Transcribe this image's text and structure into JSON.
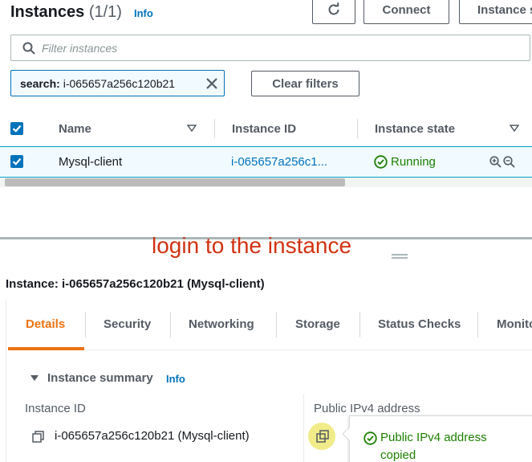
{
  "header": {
    "title": "Instances",
    "count": "(1/1)",
    "info": "Info",
    "connect_label": "Connect",
    "instance_state_label": "Instance s"
  },
  "search": {
    "placeholder": "Filter instances"
  },
  "filter_token": {
    "key": "search:",
    "value": "i-065657a256c120b21"
  },
  "clear_filters_label": "Clear filters",
  "table": {
    "columns": [
      "Name",
      "Instance ID",
      "Instance state"
    ],
    "rows": [
      {
        "name": "Mysql-client",
        "instance_id": "i-065657a256c1...",
        "state": "Running"
      }
    ]
  },
  "annotation": "login to the instance",
  "details": {
    "title": "Instance: i-065657a256c120b21 (Mysql-client)",
    "tabs": [
      "Details",
      "Security",
      "Networking",
      "Storage",
      "Status Checks",
      "Monito"
    ],
    "active_tab": "Details",
    "summary_label": "Instance summary",
    "summary_info": "Info",
    "instance_id_label": "Instance ID",
    "instance_id_value": "i-065657a256c120b21 (Mysql-client)",
    "public_ipv4_label": "Public IPv4 address",
    "copied_tooltip": "Public IPv4 address copied"
  },
  "colors": {
    "accent": "#0073bb",
    "running": "#1d8102",
    "active_tab": "#ec7211",
    "annotation": "#d13212"
  }
}
